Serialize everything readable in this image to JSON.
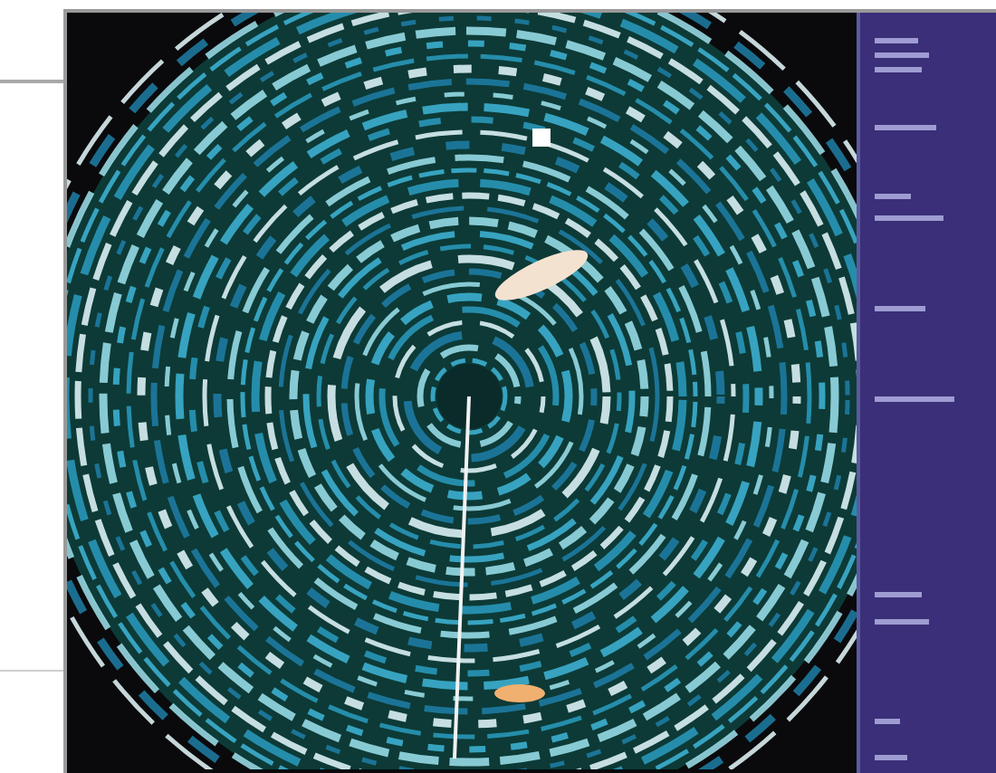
{
  "screen": {
    "kind": "radar"
  }
}
